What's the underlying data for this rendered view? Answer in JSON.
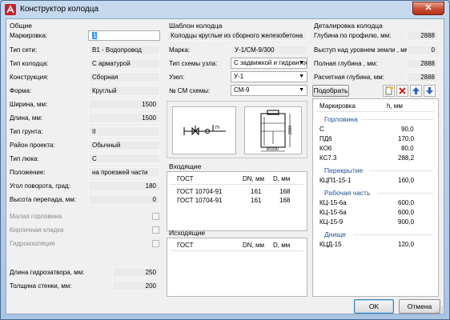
{
  "window": {
    "title": "Конструктор колодца",
    "close_glyph": "✕"
  },
  "general": {
    "title": "Общие",
    "marking": {
      "label": "Маркировка:",
      "value": "1"
    },
    "network_type": {
      "label": "Тип сети:",
      "value": "B1 - Водопровод"
    },
    "well_type": {
      "label": "Тип колодца:",
      "value": "С арматурой"
    },
    "construction": {
      "label": "Конструкция:",
      "value": "Сборная"
    },
    "shape": {
      "label": "Форма:",
      "value": "Круглый"
    },
    "width": {
      "label": "Ширина, мм:",
      "value": "1500"
    },
    "length": {
      "label": "Длина, мм:",
      "value": "1500"
    },
    "soil_type": {
      "label": "Тип грунта:",
      "value": "II"
    },
    "project_area": {
      "label": "Район проекта:",
      "value": "Обычный"
    },
    "hatch_type": {
      "label": "Тип люка:",
      "value": "С"
    },
    "position": {
      "label": "Положение:",
      "value": "на проезжей части"
    },
    "rotation_angle": {
      "label": "Угол поворота, град:",
      "value": "180"
    },
    "drop_height": {
      "label": "Высота перепада, мм:",
      "value": "0"
    },
    "small_neck": {
      "label": "Малая горловина",
      "checked": false
    },
    "brick_masonry": {
      "label": "Кирпичная кладка",
      "checked": false
    },
    "waterproofing": {
      "label": "Гидроизоляция",
      "checked": false
    },
    "seal_length": {
      "label": "Длина гидрозатвора, мм:",
      "value": "250"
    },
    "wall_thickness": {
      "label": "Толщина стенки, мм:",
      "value": "200"
    }
  },
  "template": {
    "title": "Шаблон колодца",
    "name": "Колодцы круглые из сборного железобетона",
    "marka": {
      "label": "Марка:",
      "value": "У-1/СМ-9/300"
    },
    "node_scheme_type": {
      "label": "Тип схемы узла:",
      "value": "С задвижкой и гидрантом"
    },
    "node": {
      "label": "Узел:",
      "value": "У-1"
    },
    "cm_scheme": {
      "label": "№ СМ схемы:",
      "value": "СМ-9"
    },
    "preview_dim_height": "2300",
    "preview_dim_width": "Ø1000",
    "scheme_label": "Пг"
  },
  "incoming": {
    "title": "Входящие",
    "columns": [
      "ГОСТ",
      "DN, мм",
      "D, мм"
    ],
    "rows": [
      [
        "ГОСТ 10704-91",
        "161",
        "168"
      ],
      [
        "ГОСТ 10704-91",
        "161",
        "168"
      ]
    ]
  },
  "outgoing": {
    "title": "Исходящие",
    "columns": [
      "ГОСТ",
      "DN, мм",
      "D, мм"
    ],
    "rows": []
  },
  "detail": {
    "title": "Деталировка колодца",
    "profile_depth": {
      "label": "Глубина по профилю, мм:",
      "value": "2888"
    },
    "ground_offset": {
      "label": "Выступ над уровнем земли , мм:",
      "value": "0"
    },
    "full_depth": {
      "label": "Полная глубина , мм:",
      "value": "2888"
    },
    "calc_depth": {
      "label": "Расчетная глубина, мм:",
      "value": "2888"
    },
    "select_button": "Подобрать",
    "columns": [
      "Маркировка",
      "h, мм"
    ],
    "sections": [
      {
        "name": "Горловина",
        "items": [
          {
            "mark": "С",
            "h": "90,0"
          },
          {
            "mark": "ПД6",
            "h": "170,0"
          },
          {
            "mark": "КО6",
            "h": "80,0"
          },
          {
            "mark": "КС7.3",
            "h": "288,2"
          }
        ]
      },
      {
        "name": "Перекрытие",
        "items": [
          {
            "mark": "КЦП1-15-1",
            "h": "160,0"
          }
        ]
      },
      {
        "name": "Рабочая часть",
        "items": [
          {
            "mark": "КЦ-15-6а",
            "h": "600,0"
          },
          {
            "mark": "КЦ-15-6а",
            "h": "600,0"
          },
          {
            "mark": "КЦ-15-9",
            "h": "900,0"
          }
        ]
      },
      {
        "name": "Днище",
        "items": [
          {
            "mark": "КЦД-15",
            "h": "120,0"
          }
        ]
      }
    ]
  },
  "buttons": {
    "ok": "OK",
    "cancel": "Отмена"
  },
  "colors": {
    "section_heading": "#1e4f91",
    "delete_icon": "#d02020",
    "arrow_icon": "#2a64c4"
  }
}
